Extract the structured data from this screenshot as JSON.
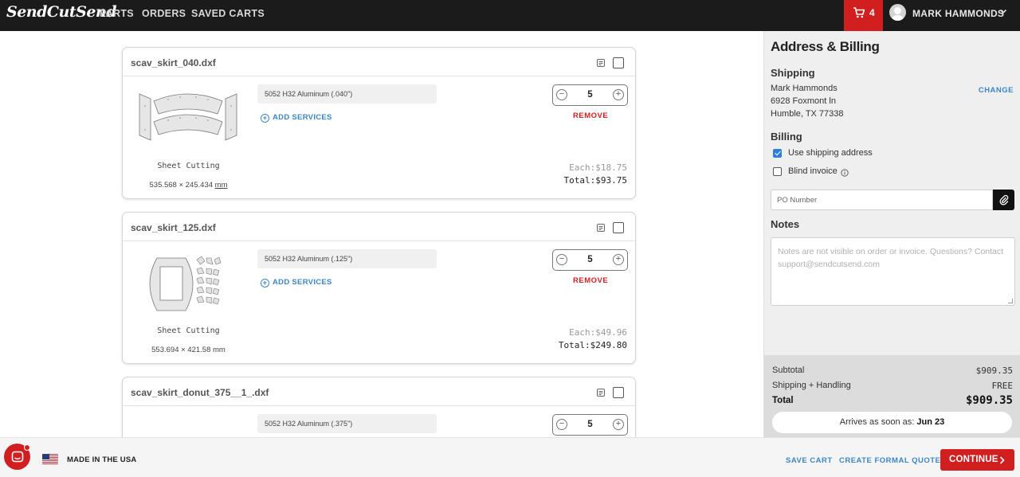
{
  "nav": {
    "logo": "SendCutSend",
    "links": [
      "PARTS",
      "ORDERS",
      "SAVED CARTS"
    ],
    "cart_count": "4",
    "user_name": "MARK HAMMONDS"
  },
  "cart": {
    "items": [
      {
        "filename": "scav_skirt_040.dxf",
        "process": "Sheet Cutting",
        "dims": "535.568 × 245.434",
        "unit": "mm",
        "material": "5052 H32 Aluminum (.040\")",
        "add_services": "ADD SERVICES",
        "quantity": "5",
        "remove": "REMOVE",
        "each": "Each:$18.75",
        "total": "Total:$93.75"
      },
      {
        "filename": "scav_skirt_125.dxf",
        "process": "Sheet Cutting",
        "dims": "553.694 × 421.58 mm",
        "material": "5052 H32 Aluminum (.125\")",
        "add_services": "ADD SERVICES",
        "quantity": "5",
        "remove": "REMOVE",
        "each": "Each:$49.96",
        "total": "Total:$249.80"
      },
      {
        "filename": "scav_skirt_donut_375__1_.dxf",
        "material": "5052 H32 Aluminum (.375\")",
        "quantity": "5"
      }
    ]
  },
  "panel": {
    "title": "Address & Billing",
    "shipping_label": "Shipping",
    "address": [
      "Mark Hammonds",
      "6928 Foxmont ln",
      "Humble, TX 77338"
    ],
    "change": "CHANGE",
    "billing_label": "Billing",
    "use_shipping": "Use shipping address",
    "blind_invoice": "Blind invoice",
    "po_placeholder": "PO Number",
    "notes_label": "Notes",
    "notes_placeholder": "Notes are not visible on order or invoice. Questions? Contact support@sendcutsend.com",
    "summary": {
      "subtotal_label": "Subtotal",
      "subtotal": "$909.35",
      "shipping_label": "Shipping + Handling",
      "shipping": "FREE",
      "total_label": "Total",
      "total": "$909.35",
      "arrives_label": "Arrives as soon as:",
      "arrives_date": "Jun 23"
    }
  },
  "footer": {
    "made_in": "MADE IN THE USA",
    "save_cart": "SAVE CART",
    "formal_quote": "CREATE FORMAL QUOTE",
    "continue": "CONTINUE"
  },
  "colors": {
    "accent_red": "#d11f1f",
    "link_blue": "#3c86c6",
    "nav_bg": "#1b1b1b"
  },
  "icons": [
    "cart-icon",
    "chevron-down-icon",
    "document-icon",
    "plus-circle-icon",
    "minus-icon",
    "plus-icon",
    "info-icon",
    "paperclip-icon",
    "chat-icon",
    "us-flag-icon",
    "chevron-right-icon"
  ]
}
